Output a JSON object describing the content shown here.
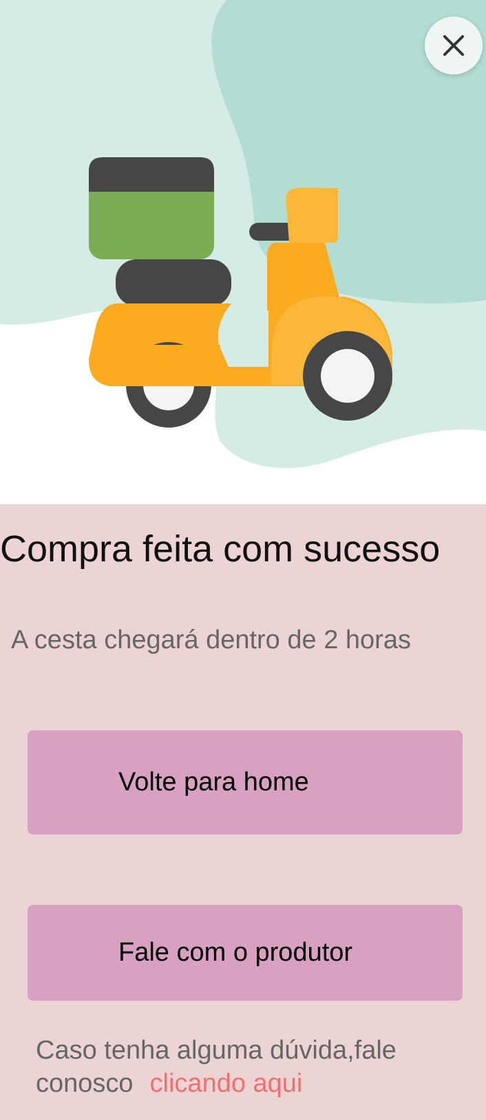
{
  "colors": {
    "page_background": "#ecd3d4",
    "hero_background": "#ffffff",
    "blob_light": "#d4ebe6",
    "blob_dark": "#b2ddd4",
    "button_background": "#d8a1c2",
    "link_color": "#f07070",
    "scooter_body": "#fbab21",
    "scooter_dark": "#464646",
    "basket_green": "#7aad54"
  },
  "hero": {
    "illustration": "delivery-scooter-illustration",
    "close_icon": "close-icon"
  },
  "main": {
    "title": "Compra feita com sucesso",
    "subtitle": "A cesta chegará dentro de 2 horas",
    "home_button_label": "Volte para home",
    "producer_button_label": "Fale com o produtor",
    "help_text": "Caso tenha alguma dúvida,fale conosco",
    "help_link": "clicando aqui"
  }
}
